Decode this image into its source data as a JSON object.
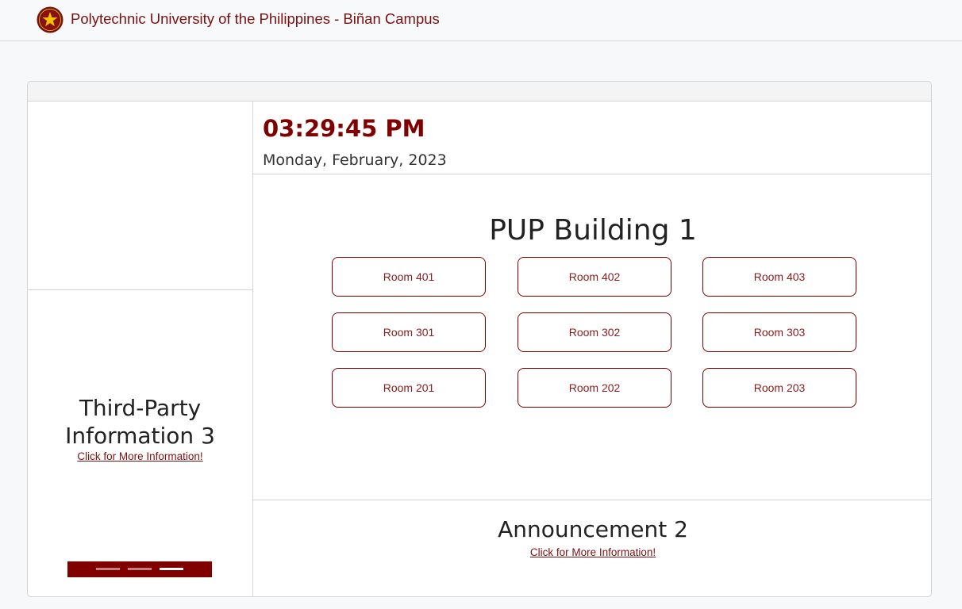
{
  "navbar": {
    "logo_icon": "university-seal-icon",
    "title": "Polytechnic University of the Philippines - Biñan Campus"
  },
  "clock": {
    "time": "03:29:45 PM",
    "date": "Monday, February, 2023"
  },
  "third_party": {
    "title_line1": "Third-Party",
    "title_line2": "Information 3",
    "link": "Click for More Information!",
    "carousel_slides": 3,
    "active_slide": 3
  },
  "building": {
    "title": "PUP Building 1",
    "rooms": [
      [
        "Room 401",
        "Room 402",
        "Room 403"
      ],
      [
        "Room 301",
        "Room 302",
        "Room 303"
      ],
      [
        "Room 201",
        "Room 202",
        "Room 203"
      ]
    ]
  },
  "announcement": {
    "title": "Announcement 2",
    "link": "Click for More Information!"
  },
  "colors": {
    "primary": "#800000",
    "link": "#7c1010",
    "page_bg": "#f7f8fa",
    "logo_gold": "#f2c200"
  }
}
